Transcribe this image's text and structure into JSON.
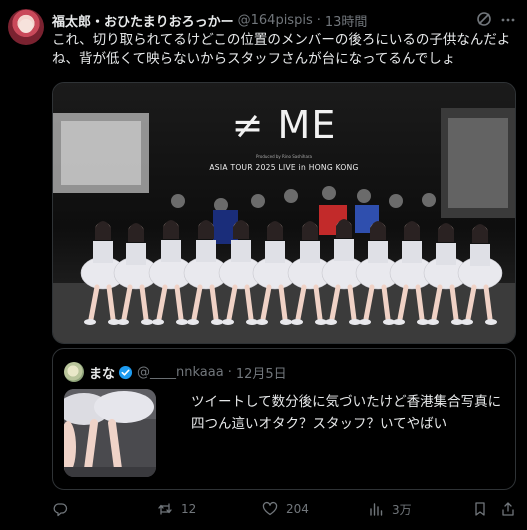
{
  "tweet": {
    "author_name": "福太郎・おひたまりおろっかー",
    "handle": "@164pispis",
    "separator": "·",
    "time": "13時間",
    "text": "これ、切り取られてるけどこの位置のメンバーの後ろにいるの子供なんだよね、背が低くて映らないからスタッフさんが台になってるんでしょ"
  },
  "media": {
    "logo": "≠ ME",
    "produced_by": "Produced by Rino Sashihara",
    "tour_caption": "ASIA TOUR 2025 LIVE in HONG KONG"
  },
  "quote": {
    "author_name": "まな",
    "handle": "@____nnkaaa",
    "separator": "·",
    "date": "12月5日",
    "text": "ツイートして数分後に気づいたけど香港集合写真に四つん這いオタク？スタッフ？いてやばい"
  },
  "actions": {
    "replies": "",
    "retweets": "12",
    "likes": "204",
    "views": "3万"
  },
  "colors": {
    "background": "#000000",
    "text_primary": "#e7e9ea",
    "text_secondary": "#71767b",
    "border": "#2f3336",
    "verified_blue": "#1d9bf0"
  },
  "icons": [
    "grok-icon",
    "more-icon",
    "verified-icon",
    "reply-icon",
    "retweet-icon",
    "like-icon",
    "views-icon",
    "bookmark-icon",
    "share-icon"
  ]
}
